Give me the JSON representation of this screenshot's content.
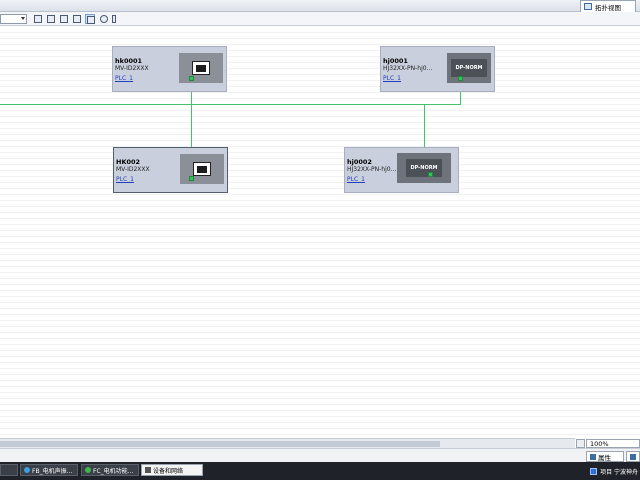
{
  "top_tab": {
    "label": "拓扑视图",
    "icon": "topology-icon"
  },
  "toolbar": {
    "zoom_value": "",
    "buttons": [
      "grid-icon",
      "list-icon",
      "table-icon",
      "overview-icon",
      "zoom-icon",
      "pan-icon"
    ]
  },
  "devices": [
    {
      "name": "hk0001",
      "type": "MV-ID2XXX",
      "link": "PLC_1",
      "kind": "camera"
    },
    {
      "name": "hj0001",
      "type": "HJ32XX-PN-hj0...",
      "link": "PLC_1",
      "kind": "dp",
      "badge": "DP-NORM"
    },
    {
      "name": "HK002",
      "type": "MV-ID2XXX",
      "link": "PLC_1",
      "kind": "camera"
    },
    {
      "name": "hj0002",
      "type": "HJ32XX-PN-hj0...",
      "link": "PLC_1",
      "kind": "dp",
      "badge": "DP-NORM"
    }
  ],
  "zoom_level": "100%",
  "properties": {
    "tab1": "属性",
    "tab2": ""
  },
  "taskbar": {
    "items": [
      {
        "label": "FB_电机声振..."
      },
      {
        "label": "FC_电机功能..."
      },
      {
        "label": "设备和网络"
      }
    ],
    "tray_label": "项目 宁波神舟"
  },
  "colors": {
    "network_line": "#45c16b",
    "device_bg": "#c9cfdc",
    "link": "#1f3fbf"
  }
}
